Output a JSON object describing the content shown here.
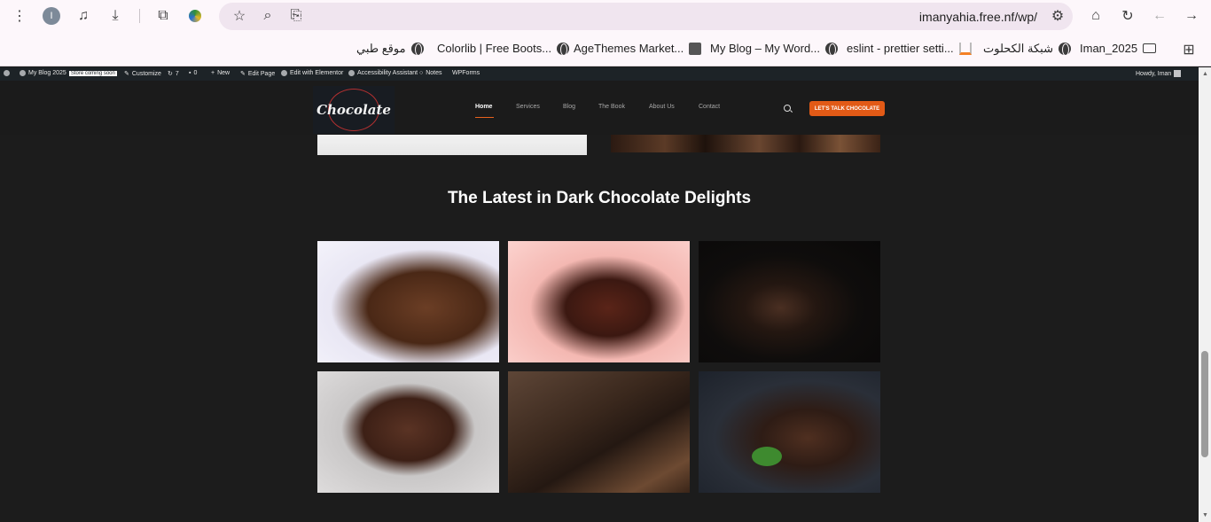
{
  "browser": {
    "url": "imanyahia.free.nf/wp/",
    "profile_initial": "I",
    "icons": [
      "menu-dots-icon",
      "media-icon",
      "download-icon",
      "extensions-icon",
      "extension-colorful-icon",
      "star-icon",
      "zoom-icon",
      "translate-icon",
      "site-settings-icon",
      "home-icon",
      "reload-icon",
      "back-icon",
      "forward-icon"
    ]
  },
  "bookmarks": {
    "items": [
      {
        "label": "موقع طبي",
        "icon": "globe-icon"
      },
      {
        "label": "Colorlib | Free Boots...",
        "icon": "globe-icon"
      },
      {
        "label": "AgeThemes Market...",
        "icon": "agethemes-icon"
      },
      {
        "label": "My Blog – My Word...",
        "icon": "globe-icon"
      },
      {
        "label": "eslint - prettier setti...",
        "icon": "stackoverflow-icon"
      },
      {
        "label": "شبكة الكحلوت",
        "icon": "globe-icon"
      },
      {
        "label": "Iman_2025",
        "icon": "folder-icon"
      }
    ]
  },
  "adminbar": {
    "site_name": "My Blog 2025",
    "badge": "Store coming soon",
    "customize": "Customize",
    "updates_count": "7",
    "comments_count": "0",
    "new": "New",
    "edit_page": "Edit Page",
    "elementor": "Edit with Elementor",
    "accessibility": "Accessibility Assistant",
    "notes": "Notes",
    "wpforms": "WPForms",
    "howdy": "Howdy, Iman"
  },
  "site": {
    "logo_text": "Chocolate",
    "nav": [
      "Home",
      "Services",
      "Blog",
      "The Book",
      "About Us",
      "Contact"
    ],
    "active_nav": "Home",
    "cta": "LET'S TALK CHOCOLATE",
    "accent_color": "#e25a16"
  },
  "main": {
    "section_title": "The Latest in Dark Chocolate Delights",
    "gallery": [
      {
        "name": "chocolate-bar-shavings-image"
      },
      {
        "name": "chocolate-stack-berry-image"
      },
      {
        "name": "chocolate-stack-dark-image"
      },
      {
        "name": "chocolate-bar-white-image"
      },
      {
        "name": "chocolate-bar-closeup-image"
      },
      {
        "name": "chocolate-stack-mint-image"
      }
    ]
  }
}
